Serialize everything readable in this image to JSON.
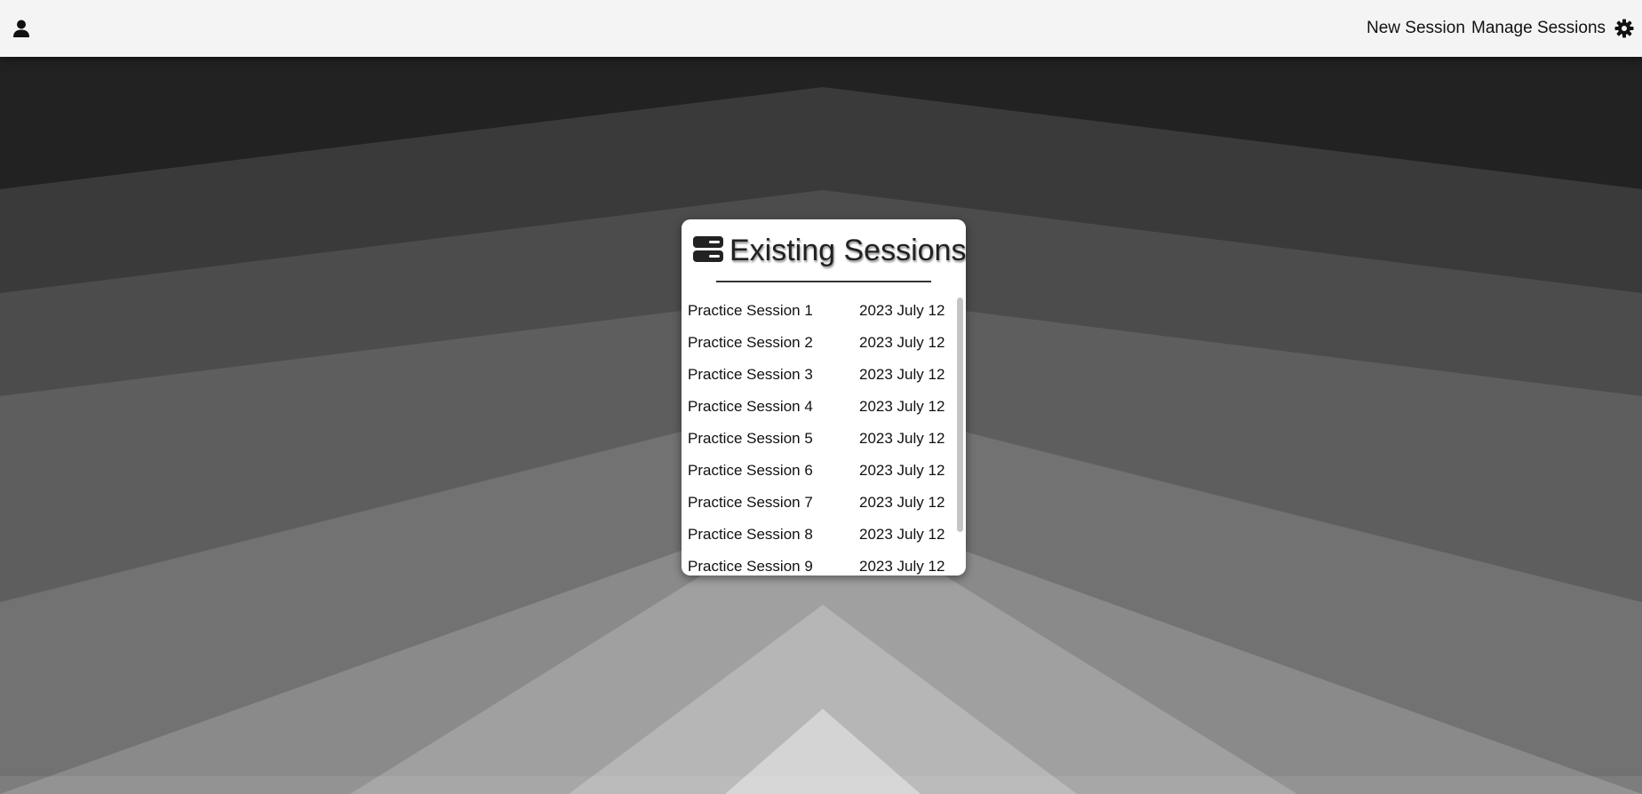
{
  "topbar": {
    "user_icon": "user-icon",
    "nav": [
      {
        "label": "New Session"
      },
      {
        "label": "Manage Sessions"
      }
    ],
    "settings_icon": "gear-icon"
  },
  "panel": {
    "icon": "server-icon",
    "title": "Existing Sessions",
    "sessions": [
      {
        "name": "Practice Session 1",
        "date": "2023 July 12"
      },
      {
        "name": "Practice Session 2",
        "date": "2023 July 12"
      },
      {
        "name": "Practice Session 3",
        "date": "2023 July 12"
      },
      {
        "name": "Practice Session 4",
        "date": "2023 July 12"
      },
      {
        "name": "Practice Session 5",
        "date": "2023 July 12"
      },
      {
        "name": "Practice Session 6",
        "date": "2023 July 12"
      },
      {
        "name": "Practice Session 7",
        "date": "2023 July 12"
      },
      {
        "name": "Practice Session 8",
        "date": "2023 July 12"
      },
      {
        "name": "Practice Session 9",
        "date": "2023 July 12"
      }
    ]
  }
}
